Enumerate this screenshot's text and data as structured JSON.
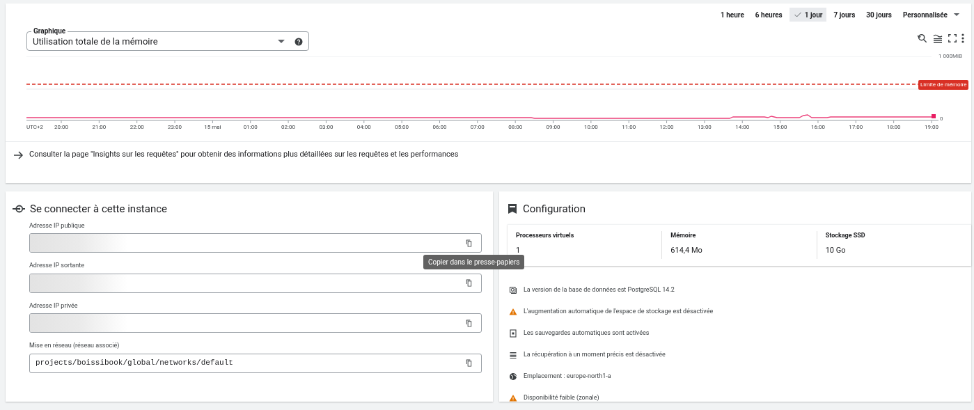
{
  "time_ranges": [
    {
      "label": "1 heure",
      "selected": false
    },
    {
      "label": "6 heures",
      "selected": false
    },
    {
      "label": "1 jour",
      "selected": true
    },
    {
      "label": "7 jours",
      "selected": false
    },
    {
      "label": "30 jours",
      "selected": false
    }
  ],
  "custom_range": "Personnalisée",
  "chart_select": {
    "label": "Graphique",
    "value": "Utilisation totale de la mémoire"
  },
  "chart": {
    "y_top": "1 000MiB",
    "y_zero": "0",
    "limit_label": "Limite de mémoire",
    "timezone": "UTC+2",
    "x_labels": [
      "20:00",
      "21:00",
      "22:00",
      "23:00",
      "15 mai",
      "01:00",
      "02:00",
      "03:00",
      "04:00",
      "05:00",
      "06:00",
      "07:00",
      "08:00",
      "09:00",
      "10:00",
      "11:00",
      "12:00",
      "13:00",
      "14:00",
      "15:00",
      "16:00",
      "17:00",
      "18:00",
      "19:00"
    ]
  },
  "insights_link": "Consulter la page \"Insights sur les requêtes\" pour obtenir des informations plus détaillées sur les requêtes et les performances",
  "connect": {
    "title": "Se connecter à cette instance",
    "fields": [
      {
        "label": "Adresse IP publique",
        "redacted": true
      },
      {
        "label": "Adresse IP sortante",
        "redacted": true
      },
      {
        "label": "Adresse IP privée",
        "redacted": true
      },
      {
        "label": "Mise en réseau (réseau associé)",
        "redacted": false,
        "value": "projects/boissibook/global/networks/default"
      }
    ],
    "tooltip": "Copier dans le presse-papiers"
  },
  "configuration": {
    "title": "Configuration",
    "specs": [
      {
        "label": "Processeurs virtuels",
        "value": "1"
      },
      {
        "label": "Mémoire",
        "value": "614,4 Mo"
      },
      {
        "label": "Stockage SSD",
        "value": "10 Go"
      }
    ],
    "items": [
      {
        "kind": "version",
        "text": "La version de la base de données est PostgreSQL 14.2"
      },
      {
        "kind": "warning",
        "text": "L'augmentation automatique de l'espace de stockage est désactivée"
      },
      {
        "kind": "backup",
        "text": "Les sauvegardes automatiques sont activées"
      },
      {
        "kind": "recovery",
        "text": "La récupération à un moment précis est désactivée"
      },
      {
        "kind": "location",
        "text": "Emplacement : europe-north1-a"
      },
      {
        "kind": "warning",
        "text": "Disponibilité faible (zonale)"
      }
    ]
  }
}
